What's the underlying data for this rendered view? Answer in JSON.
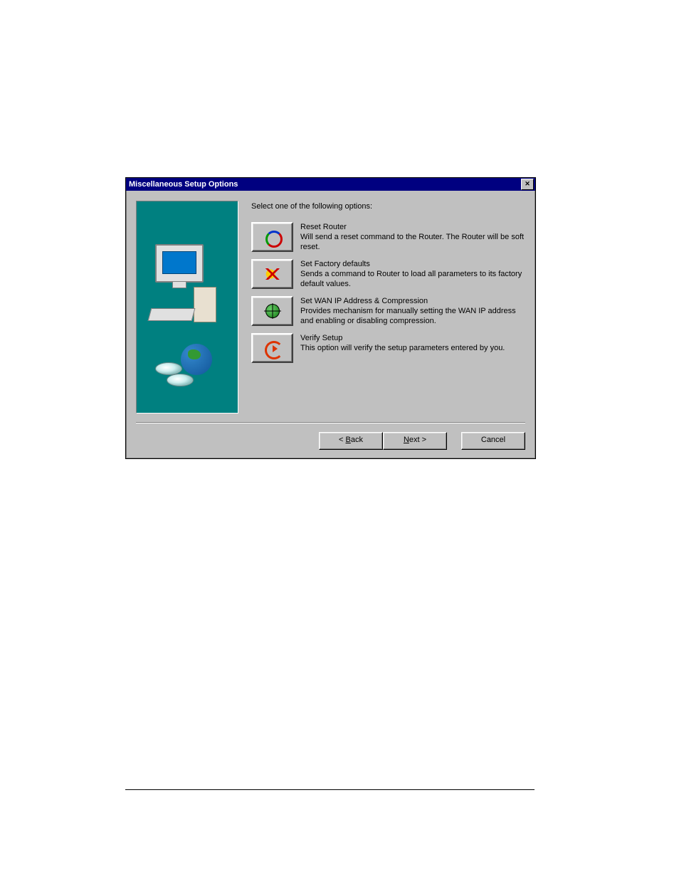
{
  "dialog": {
    "title": "Miscellaneous Setup Options",
    "prompt": "Select one of the following options:"
  },
  "options": [
    {
      "title": "Reset Router",
      "desc": "Will send a reset command to the Router. The Router will be soft reset."
    },
    {
      "title": "Set Factory defaults",
      "desc": "Sends a command to Router to load  all parameters to its factory default values."
    },
    {
      "title": "Set WAN IP Address & Compression",
      "desc": "Provides mechanism for manually setting the WAN IP address and enabling or disabling compression."
    },
    {
      "title": "Verify Setup",
      "desc": "This option will verify the setup parameters entered by you."
    }
  ],
  "buttons": {
    "back_prefix": "< ",
    "back_mn": "B",
    "back_rest": "ack",
    "next_mn": "N",
    "next_rest": "ext >",
    "cancel": "Cancel"
  }
}
